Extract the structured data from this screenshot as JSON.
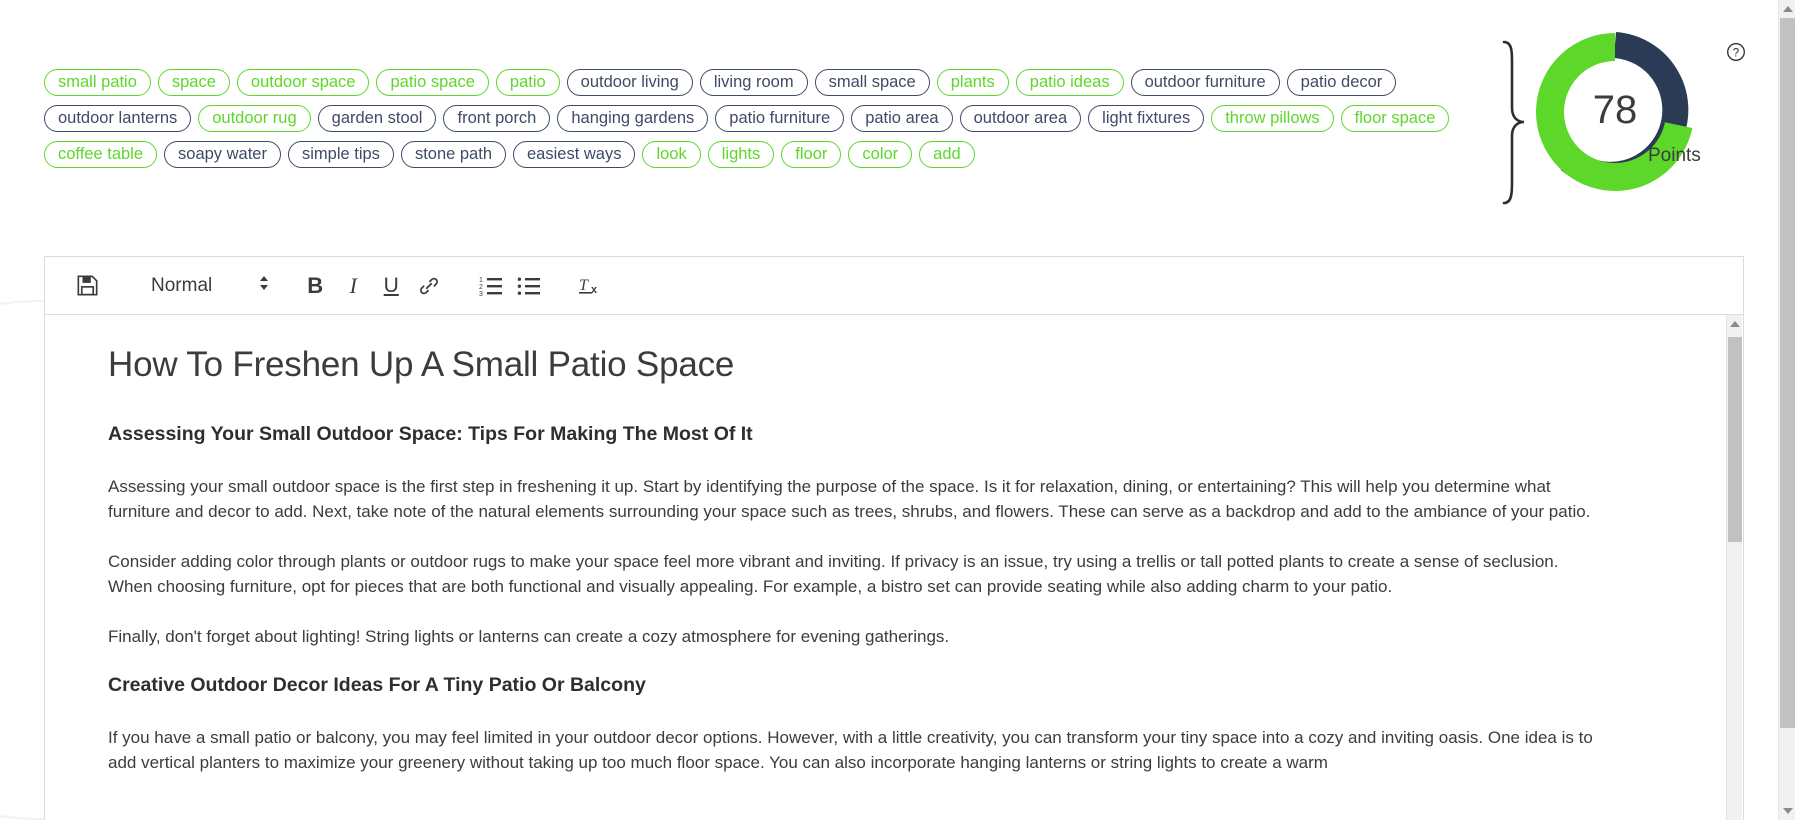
{
  "keywords": {
    "rows": [
      [
        {
          "label": "small patio",
          "used": true
        },
        {
          "label": "space",
          "used": true
        },
        {
          "label": "outdoor space",
          "used": true
        },
        {
          "label": "patio space",
          "used": true
        },
        {
          "label": "patio",
          "used": true
        },
        {
          "label": "outdoor living",
          "used": false
        },
        {
          "label": "living room",
          "used": false
        },
        {
          "label": "small space",
          "used": false
        },
        {
          "label": "plants",
          "used": true
        },
        {
          "label": "patio ideas",
          "used": true
        },
        {
          "label": "outdoor furniture",
          "used": false
        },
        {
          "label": "patio decor",
          "used": false
        }
      ],
      [
        {
          "label": "outdoor lanterns",
          "used": false
        },
        {
          "label": "outdoor rug",
          "used": true
        },
        {
          "label": "garden stool",
          "used": false
        },
        {
          "label": "front porch",
          "used": false
        },
        {
          "label": "hanging gardens",
          "used": false
        },
        {
          "label": "patio furniture",
          "used": false
        },
        {
          "label": "patio area",
          "used": false
        },
        {
          "label": "outdoor area",
          "used": false
        },
        {
          "label": "light fixtures",
          "used": false
        },
        {
          "label": "throw pillows",
          "used": true
        },
        {
          "label": "floor space",
          "used": true
        }
      ],
      [
        {
          "label": "coffee table",
          "used": true
        },
        {
          "label": "soapy water",
          "used": false
        },
        {
          "label": "simple tips",
          "used": false
        },
        {
          "label": "stone path",
          "used": false
        },
        {
          "label": "easiest ways",
          "used": false
        },
        {
          "label": "look",
          "used": true
        },
        {
          "label": "lights",
          "used": true
        },
        {
          "label": "floor",
          "used": true
        },
        {
          "label": "color",
          "used": true
        },
        {
          "label": "add",
          "used": true
        }
      ]
    ],
    "used_color": "#5ed72b",
    "unused_color": "#3e4b66"
  },
  "gauge": {
    "value": "78",
    "max": 100,
    "label": "Points",
    "arc_color": "#5ed72b",
    "track_color": "#2b3a55"
  },
  "help": {
    "icon": "question-mark-circle-icon",
    "tooltip": "?"
  },
  "toolbar": {
    "save_label": "save-icon",
    "style_label": "Normal",
    "bold_label": "B",
    "italic_label": "I",
    "underline_label": "U",
    "link_label": "link-icon",
    "ordered_list_label": "ordered-list-icon",
    "bullet_list_label": "bullet-list-icon",
    "clear_format_label": "clear-formatting-icon"
  },
  "document": {
    "title": "How To Freshen Up A Small Patio Space",
    "blocks": [
      {
        "type": "h2",
        "text": "Assessing Your Small Outdoor Space: Tips For Making The Most Of It"
      },
      {
        "type": "p",
        "text": "Assessing your small outdoor space is the first step in freshening it up. Start by identifying the purpose of the space. Is it for relaxation, dining, or entertaining? This will help you determine what furniture and decor to add. Next, take note of the natural elements surrounding your space such as trees, shrubs, and flowers. These can serve as a backdrop and add to the ambiance of your patio."
      },
      {
        "type": "p",
        "text": "Consider adding color through plants or outdoor rugs to make your space feel more vibrant and inviting. If privacy is an issue, try using a trellis or tall potted plants to create a sense of seclusion. When choosing furniture, opt for pieces that are both functional and visually appealing. For example, a bistro set can provide seating while also adding charm to your patio."
      },
      {
        "type": "p",
        "text": "Finally, don't forget about lighting! String lights or lanterns can create a cozy atmosphere for evening gatherings."
      },
      {
        "type": "h2",
        "text": "Creative Outdoor Decor Ideas For A Tiny Patio Or Balcony"
      },
      {
        "type": "p",
        "text": "If you have a small patio or balcony, you may feel limited in your outdoor decor options. However, with a little creativity, you can transform your tiny space into a cozy and inviting oasis. One idea is to add vertical planters to maximize your greenery without taking up too much floor space. You can also incorporate hanging lanterns or string lights to create a warm"
      }
    ]
  }
}
